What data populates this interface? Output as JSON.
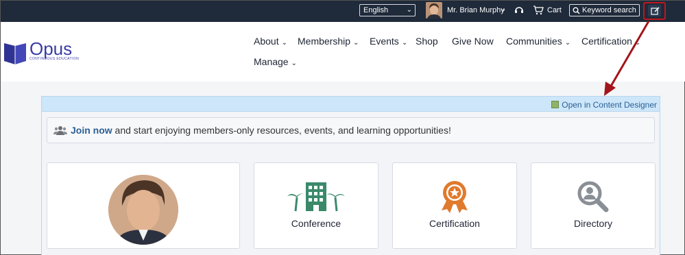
{
  "topbar": {
    "language": "English",
    "user_name": "Mr. Brian Murphy",
    "cart_label": "Cart",
    "search_label": "Keyword search"
  },
  "logo": {
    "word": "Opus",
    "tagline": "CONTINUOUS  EDUCATION"
  },
  "nav": {
    "items": [
      {
        "label": "About",
        "dropdown": true
      },
      {
        "label": "Membership",
        "dropdown": true
      },
      {
        "label": "Events",
        "dropdown": true
      },
      {
        "label": "Shop",
        "dropdown": false
      },
      {
        "label": "Give Now",
        "dropdown": false
      },
      {
        "label": "Communities",
        "dropdown": true
      },
      {
        "label": "Certification",
        "dropdown": true
      },
      {
        "label": "Manage",
        "dropdown": true
      }
    ]
  },
  "content_bar": {
    "designer_link": "Open in Content Designer"
  },
  "join": {
    "link": "Join now",
    "text": " and start enjoying members-only resources, events, and learning opportunities!"
  },
  "cards": [
    {
      "label": "Conference",
      "icon": "building-palm-icon",
      "color": "#3a8a6a"
    },
    {
      "label": "Certification",
      "icon": "award-ribbon-icon",
      "color": "#e07a2c"
    },
    {
      "label": "Directory",
      "icon": "search-person-icon",
      "color": "#8a8f96"
    }
  ],
  "colors": {
    "topbar": "#1f2a3a",
    "accent_link": "#2a5f95",
    "annotation": "#a3141a"
  }
}
